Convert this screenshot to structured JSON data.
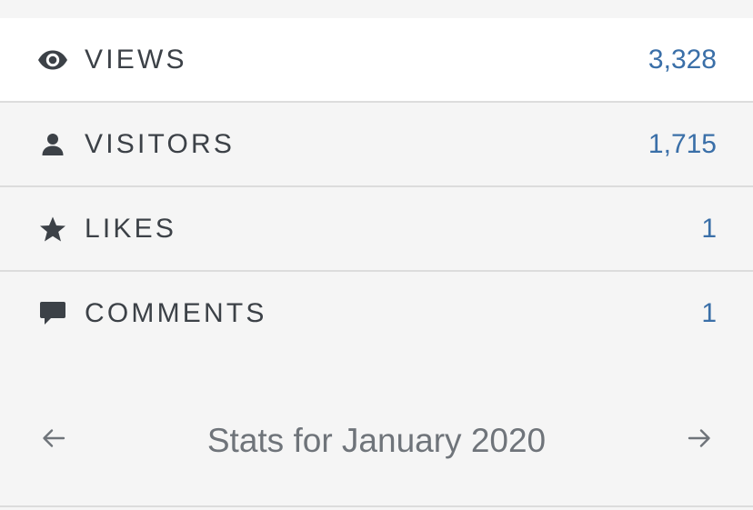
{
  "stats": [
    {
      "label": "VIEWS",
      "value": "3,328",
      "icon": "eye-icon"
    },
    {
      "label": "VISITORS",
      "value": "1,715",
      "icon": "person-icon"
    },
    {
      "label": "LIKES",
      "value": "1",
      "icon": "star-icon"
    },
    {
      "label": "COMMENTS",
      "value": "1",
      "icon": "comment-icon"
    }
  ],
  "footer": {
    "title": "Stats for January 2020",
    "prev_icon": "arrow-left-icon",
    "next_icon": "arrow-right-icon"
  },
  "colors": {
    "label": "#3c4147",
    "value": "#3a6fa8",
    "icon": "#3c4147",
    "background": "#f5f5f5",
    "highlight_row": "#ffffff",
    "divider": "#dcdcdc",
    "footer_text": "#6f747a"
  }
}
